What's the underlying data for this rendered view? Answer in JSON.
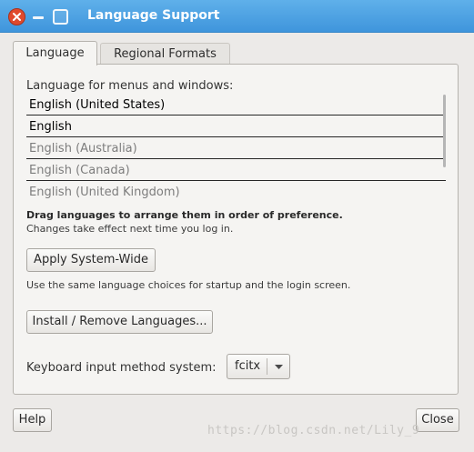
{
  "window": {
    "title": "Language Support"
  },
  "tabs": [
    {
      "label": "Language"
    },
    {
      "label": "Regional Formats"
    }
  ],
  "language": {
    "heading": "Language for menus and windows:",
    "items": [
      "English (United States)",
      "English",
      "English (Australia)",
      "English (Canada)",
      "English (United Kingdom)"
    ],
    "drag_hint": "Drag languages to arrange them in order of preference.",
    "effect_note": "Changes take effect next time you log in.",
    "apply_button": "Apply System-Wide",
    "apply_note": "Use the same language choices for startup and the login screen.",
    "install_button": "Install / Remove Languages...",
    "input_label": "Keyboard input method system:",
    "input_value": "fcitx"
  },
  "footer": {
    "help_button": "Help",
    "close_button": "Close",
    "watermark": "https://blog.csdn.net/Lily_9"
  }
}
